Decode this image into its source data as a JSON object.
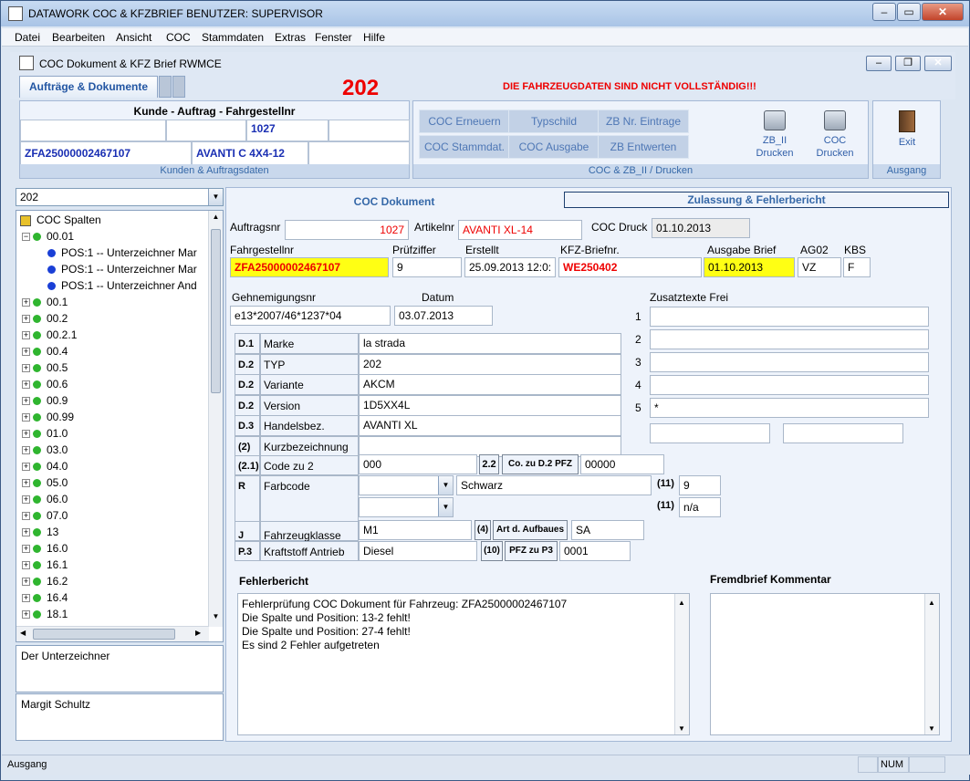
{
  "window": {
    "title": "DATAWORK COC & KFZBRIEF BENUTZER: SUPERVISOR"
  },
  "menu": [
    "Datei",
    "Bearbeiten",
    "Ansicht",
    "COC",
    "Stammdaten",
    "Extras",
    "Fenster",
    "Hilfe"
  ],
  "subwindow": {
    "title": "COC Dokument & KFZ  Brief   RWMCE"
  },
  "tabs": {
    "active": "Aufträge & Dokumente"
  },
  "header": {
    "code": "202",
    "warning": "DIE FAHRZEUGDATEN SIND NICHT VOLLSTÄNDIG!!!"
  },
  "kunde_panel": {
    "title": "Kunde  - Auftrag - Fahrgestellnr",
    "auftrag": "1027",
    "fahrgestell": "ZFA25000002467107",
    "artikel": "AVANTI C 4X4-12",
    "caption": "Kunden & Auftragsdaten"
  },
  "coc_panel": {
    "buttons": [
      "COC Erneuern",
      "Typschild",
      "ZB Nr. Eintrage",
      "COC Stammdat.",
      "COC Ausgabe",
      "ZB Entwerten"
    ],
    "print1": [
      "ZB_II",
      "Drucken"
    ],
    "print2": [
      "COC",
      "Drucken"
    ],
    "caption": "COC & ZB_II  / Drucken"
  },
  "exit_panel": {
    "label": "Exit",
    "caption": "Ausgang"
  },
  "left": {
    "combo_value": "202",
    "tree_root": "COC Spalten",
    "tree": [
      {
        "label": "00.01",
        "exp": "−",
        "dot": "green",
        "indent": 0
      },
      {
        "label": "POS:1 -- Unterzeichner Mar",
        "dot": "blue",
        "indent": 1
      },
      {
        "label": "POS:1 -- Unterzeichner Mar",
        "dot": "blue",
        "indent": 1
      },
      {
        "label": "POS:1 -- Unterzeichner And",
        "dot": "blue",
        "indent": 1
      },
      {
        "label": "00.1",
        "exp": "+",
        "dot": "green",
        "indent": 0
      },
      {
        "label": "00.2",
        "exp": "+",
        "dot": "green",
        "indent": 0
      },
      {
        "label": "00.2.1",
        "exp": "+",
        "dot": "green",
        "indent": 0
      },
      {
        "label": "00.4",
        "exp": "+",
        "dot": "green",
        "indent": 0
      },
      {
        "label": "00.5",
        "exp": "+",
        "dot": "green",
        "indent": 0
      },
      {
        "label": "00.6",
        "exp": "+",
        "dot": "green",
        "indent": 0
      },
      {
        "label": "00.9",
        "exp": "+",
        "dot": "green",
        "indent": 0
      },
      {
        "label": "00.99",
        "exp": "+",
        "dot": "green",
        "indent": 0
      },
      {
        "label": "01.0",
        "exp": "+",
        "dot": "green",
        "indent": 0
      },
      {
        "label": "03.0",
        "exp": "+",
        "dot": "green",
        "indent": 0
      },
      {
        "label": "04.0",
        "exp": "+",
        "dot": "green",
        "indent": 0
      },
      {
        "label": "05.0",
        "exp": "+",
        "dot": "green",
        "indent": 0
      },
      {
        "label": "06.0",
        "exp": "+",
        "dot": "green",
        "indent": 0
      },
      {
        "label": "07.0",
        "exp": "+",
        "dot": "green",
        "indent": 0
      },
      {
        "label": "13",
        "exp": "+",
        "dot": "green",
        "indent": 0
      },
      {
        "label": "16.0",
        "exp": "+",
        "dot": "green",
        "indent": 0
      },
      {
        "label": "16.1",
        "exp": "+",
        "dot": "green",
        "indent": 0
      },
      {
        "label": "16.2",
        "exp": "+",
        "dot": "green",
        "indent": 0
      },
      {
        "label": "16.4",
        "exp": "+",
        "dot": "green",
        "indent": 0
      },
      {
        "label": "18.1",
        "exp": "+",
        "dot": "green",
        "indent": 0
      }
    ],
    "memo1": "Der Unterzeichner",
    "memo2": "Margit Schultz"
  },
  "main": {
    "tab1": "COC Dokument",
    "tab2": "Zulassung & Fehlerbericht",
    "l_auftragsnr": "Auftragsnr",
    "auftragsnr": "1027",
    "l_artikelnr": "Artikelnr",
    "artikelnr": "AVANTI XL-14",
    "l_cocdruck": "COC Druck",
    "cocdruck": "01.10.2013",
    "l_fahrgestellnr": "Fahrgestellnr",
    "fahrgestellnr": "ZFA25000002467107",
    "l_pruefziffer": "Prüfziffer",
    "pruefziffer": "9",
    "l_erstellt": "Erstellt",
    "erstellt": "25.09.2013 12:0:",
    "l_kfzbrief": "KFZ-Briefnr.",
    "kfzbrief": "WE250402",
    "l_ausgabe": "Ausgabe Brief",
    "ausgabe": "01.10.2013",
    "l_ag02": "AG02",
    "ag02": "VZ",
    "l_kbs": "KBS",
    "kbs": "F",
    "l_gen": "Gehnemigungsnr",
    "gen": "e13*2007/46*1237*04",
    "l_datum": "Datum",
    "datum": "03.07.2013",
    "l_zusatz": "Zusatztexte Frei",
    "zusatz": [
      {
        "n": "1",
        "v": ""
      },
      {
        "n": "2",
        "v": ""
      },
      {
        "n": "3",
        "v": ""
      },
      {
        "n": "4",
        "v": ""
      },
      {
        "n": "5",
        "v": "*"
      }
    ],
    "rows": [
      {
        "code": "D.1",
        "label": "Marke",
        "value": "la strada"
      },
      {
        "code": "D.2",
        "label": "TYP",
        "value": "202"
      },
      {
        "code": "D.2",
        "label": "Variante",
        "value": "AKCM"
      },
      {
        "code": "D.2",
        "label": "Version",
        "value": "1D5XX4L"
      },
      {
        "code": "D.3",
        "label": "Handelsbez.",
        "value": "AVANTI XL"
      },
      {
        "code": "(2)",
        "label": "Kurzbezeichnung",
        "value": ""
      }
    ],
    "code21": "(2.1)",
    "l_code2": "Code zu 2",
    "code2": "000",
    "c22": "2.2",
    "l_cod2pfz": "Co. zu D.2 PFZ",
    "cod2pfz": "00000",
    "r": "R",
    "l_farb": "Farbcode",
    "farbe": "Schwarz",
    "c11a": "(11)",
    "v11a": "9",
    "c11b": "(11)",
    "v11b": "n/a",
    "j": "J",
    "l_fzk": "Fahrzeugklasse",
    "fzk": "M1",
    "c4": "(4)",
    "l_aufbau": "Art d. Aufbaues",
    "aufbau": "SA",
    "p3": "P.3",
    "l_kraft": "Kraftstoff Antrieb",
    "kraft": "Diesel",
    "c10": "(10)",
    "l_pfz3": "PFZ zu P3",
    "pfz3": "0001",
    "l_fehler": "Fehlerbericht",
    "fehler": [
      "Fehlerprüfung COC Dokument für Fahrzeug: ZFA25000002467107",
      "Die Spalte und Position: 13-2 fehlt!",
      "Die Spalte und Position: 27-4 fehlt!",
      "Es sind 2  Fehler aufgetreten"
    ],
    "l_fremd": "Fremdbrief Kommentar"
  },
  "status": {
    "left": "Ausgang",
    "num": "NUM"
  }
}
